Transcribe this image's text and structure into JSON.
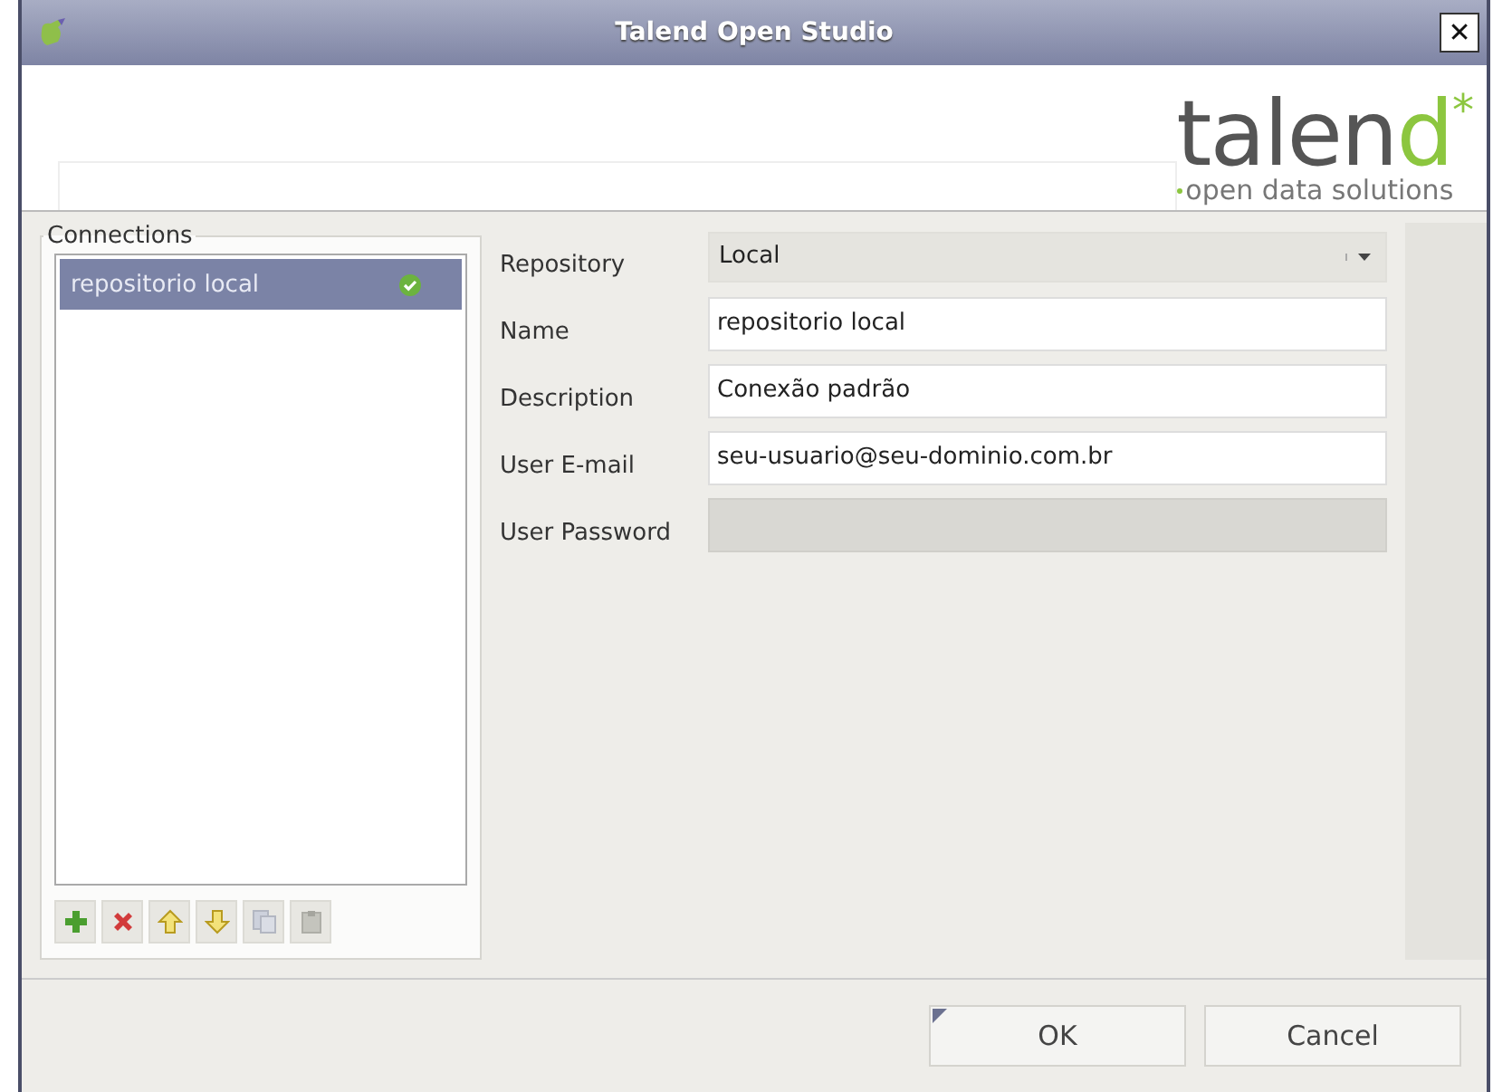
{
  "window": {
    "title": "Talend Open Studio",
    "close": "✕"
  },
  "logo": {
    "word": "talen",
    "accent": "d",
    "mark": "*",
    "tagline": "open data solutions"
  },
  "connections": {
    "title": "Connections",
    "items": [
      {
        "label": "repositorio local",
        "selected": true,
        "valid": true
      }
    ],
    "toolbar": [
      {
        "kind": "add",
        "disabled": false
      },
      {
        "kind": "delete",
        "disabled": false
      },
      {
        "kind": "up",
        "disabled": false
      },
      {
        "kind": "down",
        "disabled": false
      },
      {
        "kind": "copy",
        "disabled": true
      },
      {
        "kind": "paste",
        "disabled": true
      }
    ]
  },
  "fields": [
    {
      "label": "Repository",
      "kind": "dropdown",
      "value": "Local"
    },
    {
      "label": "Name",
      "kind": "text",
      "value": "repositorio local",
      "disabled": false
    },
    {
      "label": "Description",
      "kind": "text",
      "value": "Conexão padrão",
      "disabled": false
    },
    {
      "label": "User E-mail",
      "kind": "text",
      "value": "seu-usuario@seu-dominio.com.br",
      "disabled": false
    },
    {
      "label": "User Password",
      "kind": "password",
      "disabled": true
    }
  ],
  "buttons": [
    {
      "label": "OK",
      "default": true
    },
    {
      "label": "Cancel",
      "default": false
    }
  ]
}
